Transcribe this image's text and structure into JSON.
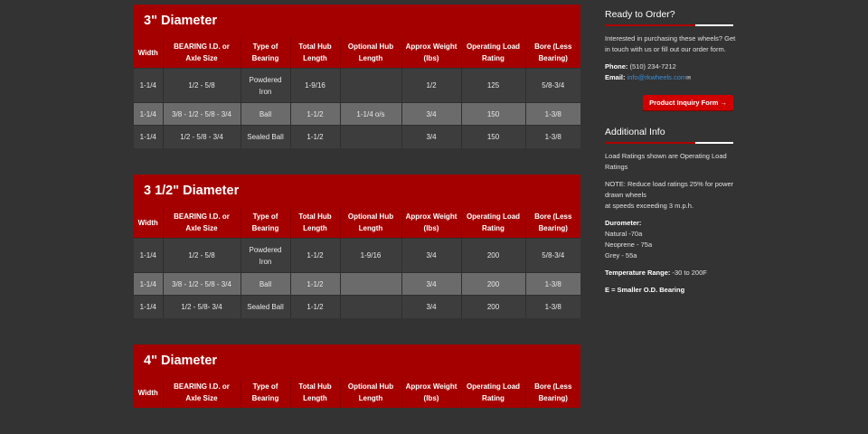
{
  "headers": [
    "Width",
    "BEARING I.D. or Axle Size",
    "Type of Bearing",
    "Total Hub Length",
    "Optional Hub Length",
    "Approx Weight (lbs)",
    "Operating Load Rating",
    "Bore (Less Bearing)"
  ],
  "panels": [
    {
      "title": "3\" Diameter",
      "rows": [
        [
          "1-1/4",
          "1/2 - 5/8",
          "Powdered Iron",
          "1-9/16",
          "",
          "1/2",
          "125",
          "5/8-3/4"
        ],
        [
          "1-1/4",
          "3/8 - 1/2 - 5/8 - 3/4",
          "Ball",
          "1-1/2",
          "1-1/4 o/s",
          "3/4",
          "150",
          "1-3/8"
        ],
        [
          "1-1/4",
          "1/2 - 5/8 - 3/4",
          "Sealed Ball",
          "1-1/2",
          "",
          "3/4",
          "150",
          "1-3/8"
        ]
      ]
    },
    {
      "title": "3 1/2\" Diameter",
      "rows": [
        [
          "1-1/4",
          "1/2 - 5/8",
          "Powdered Iron",
          "1-1/2",
          "1-9/16",
          "3/4",
          "200",
          "5/8-3/4"
        ],
        [
          "1-1/4",
          "3/8 - 1/2 - 5/8 - 3/4",
          "Ball",
          "1-1/2",
          "",
          "3/4",
          "200",
          "1-3/8"
        ],
        [
          "1-1/4",
          "1/2 - 5/8- 3/4",
          "Sealed Ball",
          "1-1/2",
          "",
          "3/4",
          "200",
          "1-3/8"
        ]
      ]
    },
    {
      "title": "4\" Diameter",
      "rows": []
    }
  ],
  "sidebar": {
    "order_title": "Ready to Order?",
    "order_text": "Interested in purchasing these wheels? Get in touch with us or fill out our order form.",
    "phone_label": "Phone:",
    "phone": "(510) 234-7212",
    "email_label": "Email:",
    "email": "info@rkwheels.com",
    "button": "Product Inquiry Form →",
    "info_title": "Additional Info",
    "info1": "Load Ratings shown are Operating Load Ratings",
    "info2a": "NOTE: Reduce load ratings 25% for power drawn wheels",
    "info2b": "at speeds exceeding 3 m.p.h.",
    "durometer_label": "Durometer:",
    "dur1": "Natural -70a",
    "dur2": "Neoprene - 75a",
    "dur3": "Grey - 55a",
    "temp_label": "Temperature Range:",
    "temp": "-30 to 200F",
    "e_note": "E = Smaller O.D. Bearing"
  },
  "icons": {
    "mail": "envelope-icon"
  }
}
